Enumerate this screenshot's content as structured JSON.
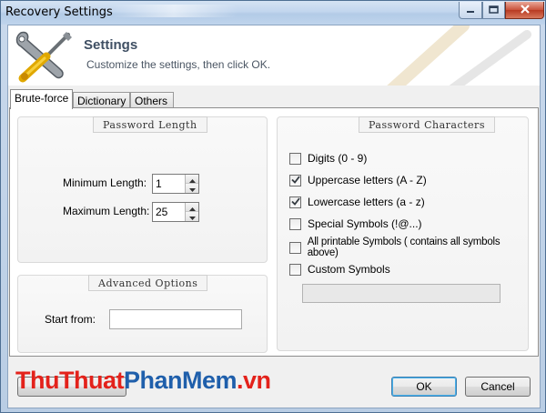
{
  "window": {
    "title": "Recovery Settings"
  },
  "header": {
    "title": "Settings",
    "subtitle": "Customize the settings, then click OK."
  },
  "tabs": [
    {
      "label": "Brute-force",
      "active": true
    },
    {
      "label": "Dictionary",
      "active": false
    },
    {
      "label": "Others",
      "active": false
    }
  ],
  "password_length": {
    "group_title": "Password Length",
    "min_label": "Minimum Length:",
    "min_value": "1",
    "max_label": "Maximum Length:",
    "max_value": "25"
  },
  "advanced_options": {
    "group_title": "Advanced Options",
    "start_from_label": "Start from:",
    "start_from_value": ""
  },
  "password_characters": {
    "group_title": "Password Characters",
    "options": [
      {
        "label": "Digits (0 - 9)",
        "checked": false
      },
      {
        "label": "Uppercase letters (A - Z)",
        "checked": true
      },
      {
        "label": "Lowercase letters (a - z)",
        "checked": true
      },
      {
        "label": "Special Symbols (!@...)",
        "checked": false
      },
      {
        "label": "All printable Symbols ( contains all symbols above)",
        "checked": false
      },
      {
        "label": "Custom Symbols",
        "checked": false
      }
    ],
    "custom_symbols_value": ""
  },
  "buttons": {
    "ok": "OK",
    "cancel": "Cancel"
  },
  "watermark": {
    "part1": "ThuThuat",
    "part2": "PhanMem",
    "part3": ".vn"
  },
  "colors": {
    "accent_red": "#e3221b",
    "accent_blue": "#1f5fab",
    "close_button": "#c9523a"
  }
}
